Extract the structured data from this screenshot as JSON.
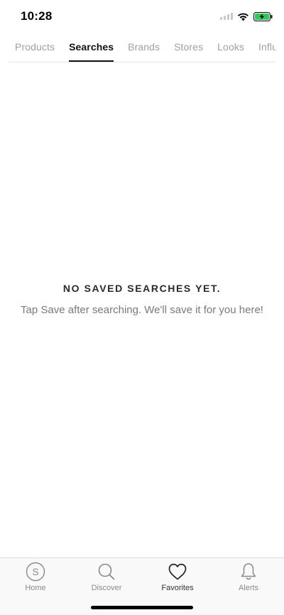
{
  "status_bar": {
    "time": "10:28",
    "battery_color": "#34c759"
  },
  "tabs": [
    {
      "label": "Products",
      "active": false
    },
    {
      "label": "Searches",
      "active": true
    },
    {
      "label": "Brands",
      "active": false
    },
    {
      "label": "Stores",
      "active": false
    },
    {
      "label": "Looks",
      "active": false
    },
    {
      "label": "Influencers",
      "active": false
    }
  ],
  "empty_state": {
    "title": "NO SAVED SEARCHES YET.",
    "subtitle": "Tap Save after searching. We'll save it for you here!"
  },
  "bottom_nav": [
    {
      "label": "Home",
      "icon": "home-s-icon",
      "active": false
    },
    {
      "label": "Discover",
      "icon": "search-icon",
      "active": false
    },
    {
      "label": "Favorites",
      "icon": "heart-icon",
      "active": true
    },
    {
      "label": "Alerts",
      "icon": "bell-icon",
      "active": false
    }
  ]
}
